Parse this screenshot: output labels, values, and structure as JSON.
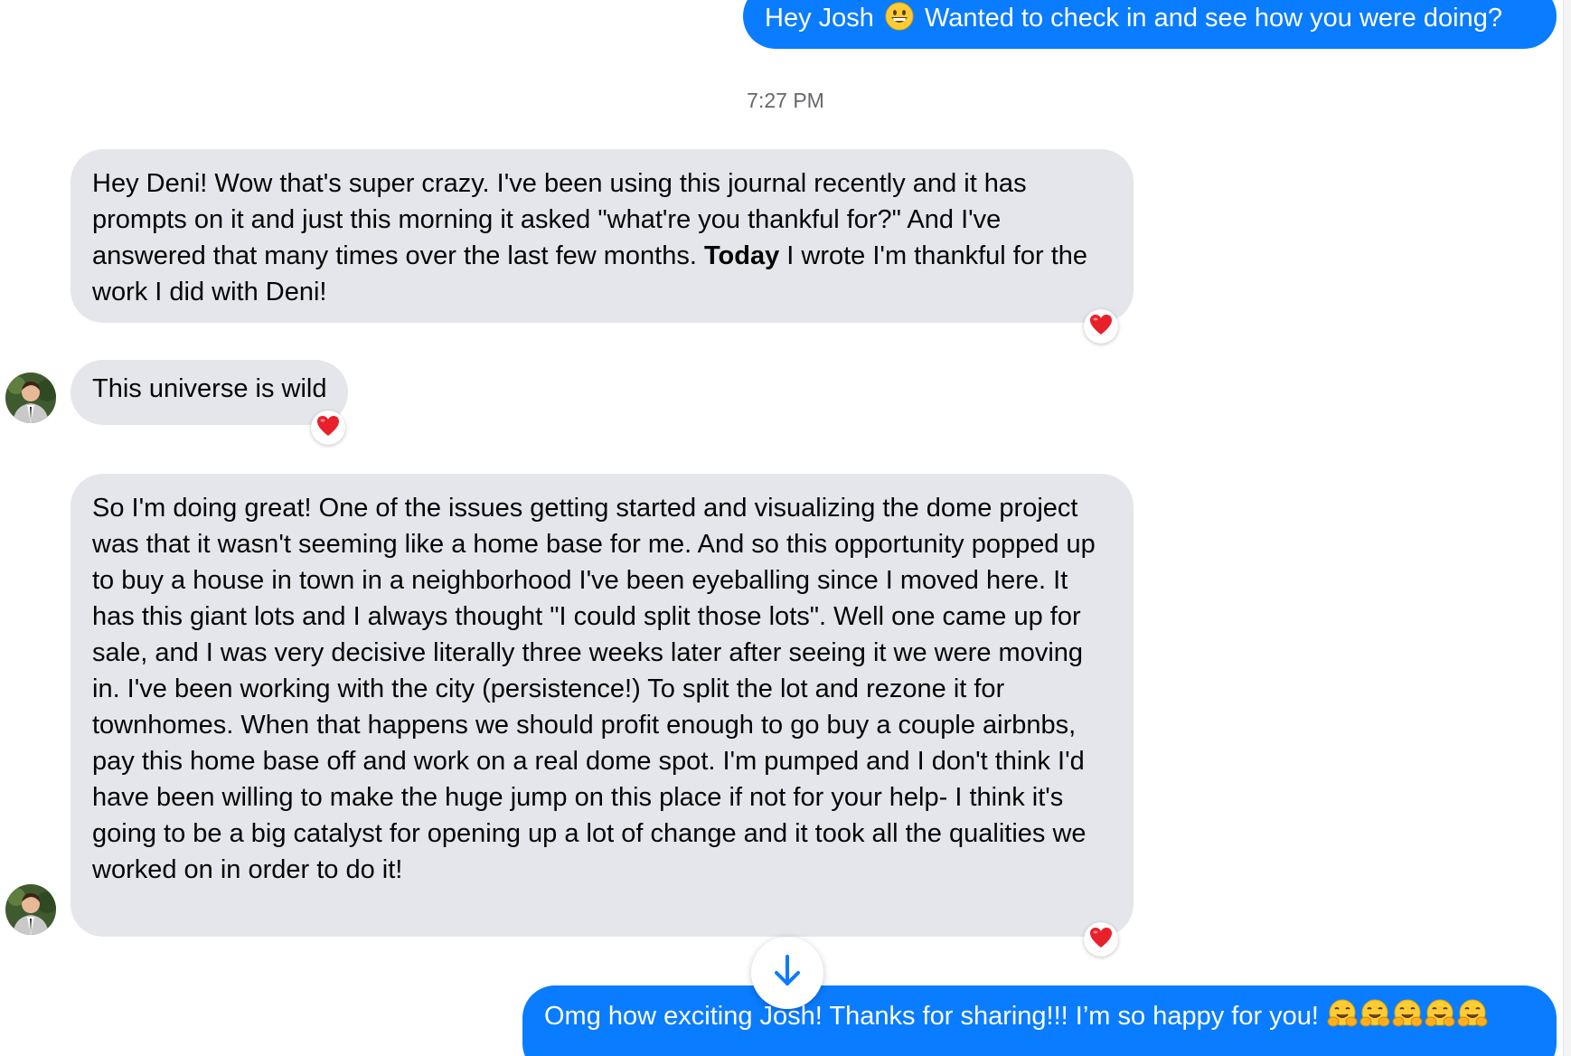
{
  "messages": {
    "sent_1": {
      "text_before": "Hey Josh ",
      "emoji": "grinning-face-icon",
      "text_after": " Wanted to check in and see how you were doing?"
    },
    "timestamp": "7:27 PM",
    "received_1": {
      "text_before": "Hey Deni! Wow that's super crazy. I've been using this journal recently and it has prompts on it and just this morning it asked \"what're you thankful for?\" And I've answered that many times over the last few months. ",
      "bold": "Today",
      "text_after": " I wrote I'm thankful for the work I did with Deni!",
      "reaction": "red-heart-icon"
    },
    "received_2": {
      "text": "This universe is wild",
      "reaction": "red-heart-icon"
    },
    "received_3": {
      "text": "So I'm doing great! One of the issues getting started and visualizing the dome project was that it wasn't seeming like a home base for me. And so this opportunity popped up to buy a house in town in a neighborhood I've been eyeballing since I moved here. It has this giant lots and I always thought \"I could split those lots\". Well one came up for sale, and I was very decisive literally three weeks later after seeing it we were moving in. I've been working with the city (persistence!) To split the lot and rezone it for townhomes. When that happens we should profit enough to go buy a couple airbnbs, pay this home base off and work on a real dome spot. I'm pumped and I don't think I'd have been willing to make the huge jump on this place if not for your help- I think it's going to be a big catalyst for opening up a lot of change and it took all the qualities we worked on in order to do it!",
      "reaction": "red-heart-icon"
    },
    "sent_2": {
      "text": "Omg how exciting Josh! Thanks for sharing!!! I’m so happy for you! ",
      "emojis": [
        "hugging-face-icon",
        "hugging-face-icon",
        "hugging-face-icon",
        "hugging-face-icon",
        "hugging-face-icon"
      ]
    }
  },
  "scroll_button": {
    "icon": "arrow-down-icon"
  },
  "colors": {
    "sent_bubble": "#0a7cff",
    "received_bubble": "#e4e6eb",
    "heart": "#e8202a"
  }
}
